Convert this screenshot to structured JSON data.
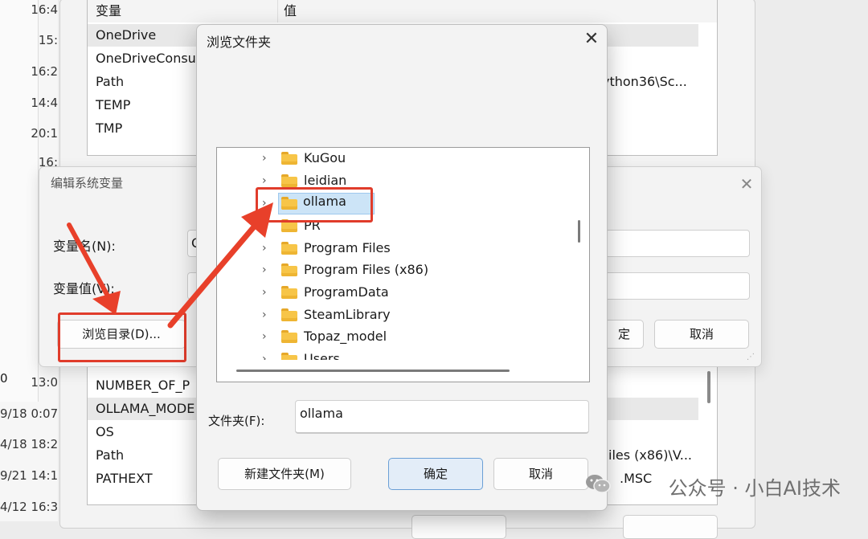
{
  "background_left": {
    "timestamps": [
      "16:4",
      "15:",
      "16:2",
      "14:4",
      "20:1",
      "16:",
      "13:0",
      "9/18 0:07",
      "4/18 18:2",
      "9/21 14:1",
      "4/12 16:3"
    ],
    "stray_text": "0"
  },
  "env_window": {
    "header": {
      "var_col": "变量",
      "value_col": "值"
    },
    "user_vars": [
      {
        "name": "OneDrive",
        "value": "",
        "selected": true
      },
      {
        "name": "OneDriveConsu",
        "value": ""
      },
      {
        "name": "Path",
        "value": "ython36\\Sc..."
      },
      {
        "name": "TEMP",
        "value": ""
      },
      {
        "name": "TMP",
        "value": ""
      }
    ],
    "system_vars": [
      {
        "name": "NUMBER_OF_P",
        "value": ""
      },
      {
        "name": "OLLAMA_MODE",
        "value": "",
        "selected": true
      },
      {
        "name": "OS",
        "value": ""
      },
      {
        "name": "Path",
        "value": "iles (x86)\\V..."
      },
      {
        "name": "PATHEXT",
        "value": ".MSC"
      }
    ]
  },
  "edit_dialog": {
    "title": "编辑系统变量",
    "var_name_label": "变量名(N):",
    "var_name_value": "O",
    "var_value_label": "变量值(V):",
    "var_value_value": "",
    "browse_dir_button": "浏览目录(D)...",
    "ok_button_partial": "定",
    "cancel_button": "取消"
  },
  "browse_dialog": {
    "title": "浏览文件夹",
    "folders": [
      {
        "label": "KuGou"
      },
      {
        "label": "leidian"
      },
      {
        "label": "ollama",
        "selected": true
      },
      {
        "label": "PR"
      },
      {
        "label": "Program Files"
      },
      {
        "label": "Program Files (x86)"
      },
      {
        "label": "ProgramData"
      },
      {
        "label": "SteamLibrary"
      },
      {
        "label": "Topaz_model"
      },
      {
        "label": "Users"
      }
    ],
    "folder_label": "文件夹(F):",
    "folder_value": "ollama",
    "new_folder_button": "新建文件夹(M)",
    "ok_button": "确定",
    "cancel_button": "取消"
  },
  "watermark": {
    "text": "公众号 · 小白AI技术"
  },
  "colors": {
    "highlight_red": "#e03c2b",
    "selection_blue": "#cce4f7",
    "primary_border": "#6a9fd6"
  }
}
